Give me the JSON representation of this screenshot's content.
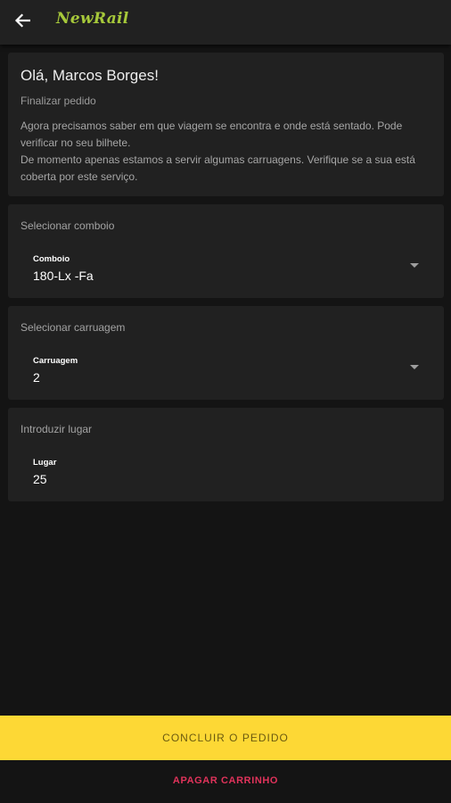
{
  "app": {
    "logo_text": "NewRail",
    "logo_color": "#a6c83a",
    "back_icon": "arrow-left-icon"
  },
  "intro": {
    "greeting": "Olá, Marcos Borges!",
    "subtitle": "Finalizar pedido",
    "paragraph_1": "Agora precisamos saber em que viagem se encontra e onde está sentado. Pode verificar no seu bilhete.",
    "paragraph_2": "De momento apenas estamos a servir algumas carruagens. Verifique se a sua está coberta por este serviço."
  },
  "train": {
    "title": "Selecionar comboio",
    "label": "Comboio",
    "value": "180-Lx -Fa"
  },
  "carriage": {
    "title": "Selecionar carruagem",
    "label": "Carruagem",
    "value": "2"
  },
  "seat": {
    "title": "Introduzir lugar",
    "label": "Lugar",
    "value": "25"
  },
  "actions": {
    "confirm_label": "CONCLUIR O PEDIDO",
    "delete_label": "APAGAR CARRINHO",
    "confirm_color": "#fdd835",
    "delete_color": "#e0335b"
  }
}
